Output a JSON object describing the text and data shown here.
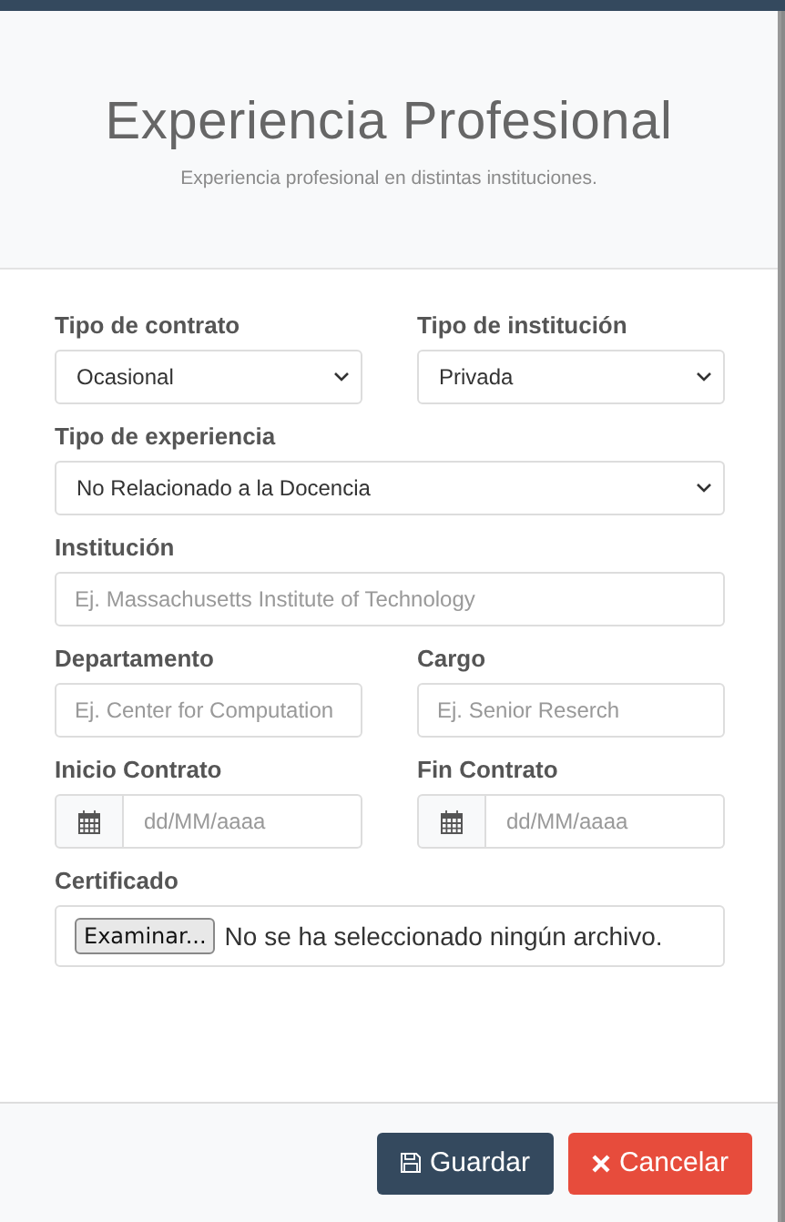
{
  "header": {
    "title": "Experiencia Profesional",
    "subtitle": "Experiencia profesional en distintas instituciones."
  },
  "rows": [
    [
      {
        "kind": "select",
        "label": "Tipo de contrato",
        "value": "Ocasional"
      },
      {
        "kind": "select",
        "label": "Tipo de institución",
        "value": "Privada"
      }
    ],
    [
      {
        "kind": "select",
        "label": "Tipo de experiencia",
        "value": "No Relacionado a la Docencia"
      }
    ],
    [
      {
        "kind": "text",
        "label": "Institución",
        "placeholder": "Ej. Massachusetts Institute of Technology"
      }
    ],
    [
      {
        "kind": "text",
        "label": "Departamento",
        "placeholder": "Ej. Center for Computation"
      },
      {
        "kind": "text",
        "label": "Cargo",
        "placeholder": "Ej. Senior Reserch"
      }
    ],
    [
      {
        "kind": "date",
        "label": "Inicio Contrato",
        "placeholder": "dd/MM/aaaa"
      },
      {
        "kind": "date",
        "label": "Fin Contrato",
        "placeholder": "dd/MM/aaaa"
      }
    ],
    [
      {
        "kind": "file",
        "label": "Certificado",
        "button": "Examinar...",
        "status": "No se ha seleccionado ningún archivo."
      }
    ]
  ],
  "buttons": [
    {
      "kind": "save",
      "label": "Guardar"
    },
    {
      "kind": "cancel",
      "label": "Cancelar"
    }
  ]
}
